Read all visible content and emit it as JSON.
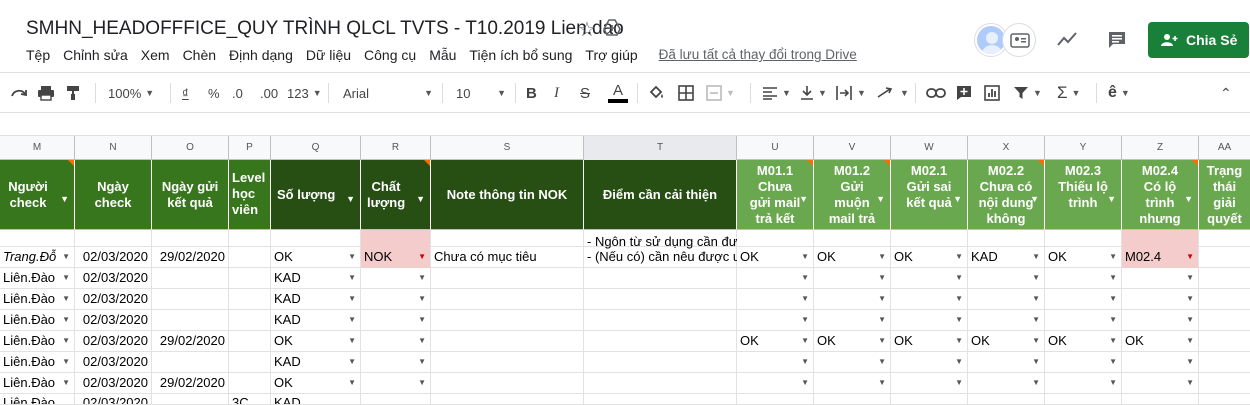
{
  "title_bar": {
    "doc_title": "SMHN_HEADOFFFICE_QUY TRÌNH QLCL TVTS - T10.2019 Lien.dao",
    "share_label": "Chia Sẻ",
    "save_status": "Đã lưu tất cả thay đổi trong Drive"
  },
  "menu": [
    "Tệp",
    "Chỉnh sửa",
    "Xem",
    "Chèn",
    "Định dạng",
    "Dữ liệu",
    "Công cụ",
    "Mẫu",
    "Tiện ích bổ sung",
    "Trợ giúp"
  ],
  "toolbar": {
    "zoom": "100%",
    "currency": "₫",
    "percent": "%",
    "dec_decrease": ".0",
    "dec_increase": ".00",
    "more_formats": "123",
    "font": "Arial",
    "font_size": "10"
  },
  "columns": [
    "M",
    "N",
    "O",
    "P",
    "Q",
    "R",
    "S",
    "T",
    "U",
    "V",
    "W",
    "X",
    "Y",
    "Z",
    "AA"
  ],
  "headers": {
    "M": "Người check",
    "N": "Ngày check",
    "O": "Ngày gửi kết quả",
    "P": "Level học viên",
    "Q": "Số lượng",
    "R": "Chất lượng",
    "S": "Note thông tin NOK",
    "T": "Điểm cần cải thiện",
    "U": "M01.1 Chưa gửi mail trả kết",
    "V": "M01.2 Gửi muộn mail trả",
    "W": "M02.1 Gửi sai kết quả",
    "X": "M02.2 Chưa có nội dung không",
    "Y": "M02.3 Thiếu lộ trình",
    "Z": "M02.4 Có lộ trình nhưng",
    "AA": "Trạng thái giải quyết NOK"
  },
  "rows": [
    {
      "M": "Trang.Đỗ",
      "N": "02/03/2020",
      "O": "29/02/2020",
      "P": "",
      "Q": "OK",
      "R": "NOK",
      "S": "Chưa có mục tiêu",
      "T1": "- Ngôn từ sử dụng cần đư",
      "T2": "- (Nếu có) cần nêu được ư",
      "U": "OK",
      "V": "OK",
      "W": "OK",
      "X": "KAD",
      "Y": "OK",
      "Z": "M02.4"
    },
    {
      "M": "Liên.Đào",
      "N": "02/03/2020",
      "O": "",
      "P": "",
      "Q": "KAD"
    },
    {
      "M": "Liên.Đào",
      "N": "02/03/2020",
      "O": "",
      "P": "",
      "Q": "KAD"
    },
    {
      "M": "Liên.Đào",
      "N": "02/03/2020",
      "O": "",
      "P": "",
      "Q": "KAD"
    },
    {
      "M": "Liên.Đào",
      "N": "02/03/2020",
      "O": "29/02/2020",
      "P": "",
      "Q": "OK",
      "U": "OK",
      "V": "OK",
      "W": "OK",
      "X": "OK",
      "Y": "OK",
      "Z": "OK"
    },
    {
      "M": "Liên.Đào",
      "N": "02/03/2020",
      "O": "",
      "P": "",
      "Q": "KAD"
    },
    {
      "M": "Liên.Đào",
      "N": "02/03/2020",
      "O": "29/02/2020",
      "P": "",
      "Q": "OK"
    },
    {
      "M": "Liên.Đào",
      "N": "02/03/2020",
      "O": "",
      "P": "3C",
      "Q": "KAD"
    }
  ],
  "colors": {
    "header_dark": "#274e13",
    "header_mid": "#38761d",
    "header_light": "#6aa84f",
    "nok_fill": "#f4cccc",
    "share_button": "#188038"
  }
}
